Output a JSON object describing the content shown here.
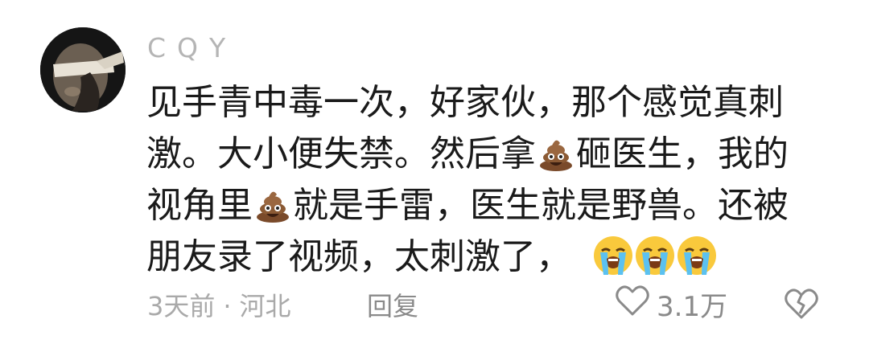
{
  "comment": {
    "author": "CQY",
    "lines": [
      {
        "a": "见手青中毒一次，好家伙，那个感觉真刺"
      },
      {
        "a": "激。大小便失禁。然后拿",
        "b": "砸医生，我的"
      },
      {
        "a": "视角里",
        "b": "就是手雷，医生就是野兽。还被"
      },
      {
        "a": "朋友录了视频，太刺激了，"
      }
    ],
    "emojis": {
      "poop": "poop-emoji",
      "cry": "loudly-crying-face-emoji"
    },
    "time": "3天前",
    "separator": "·",
    "location": "河北",
    "reply_label": "回复",
    "like_count": "3.1万",
    "icons": {
      "like": "heart-icon",
      "dislike": "broken-heart-icon"
    }
  }
}
